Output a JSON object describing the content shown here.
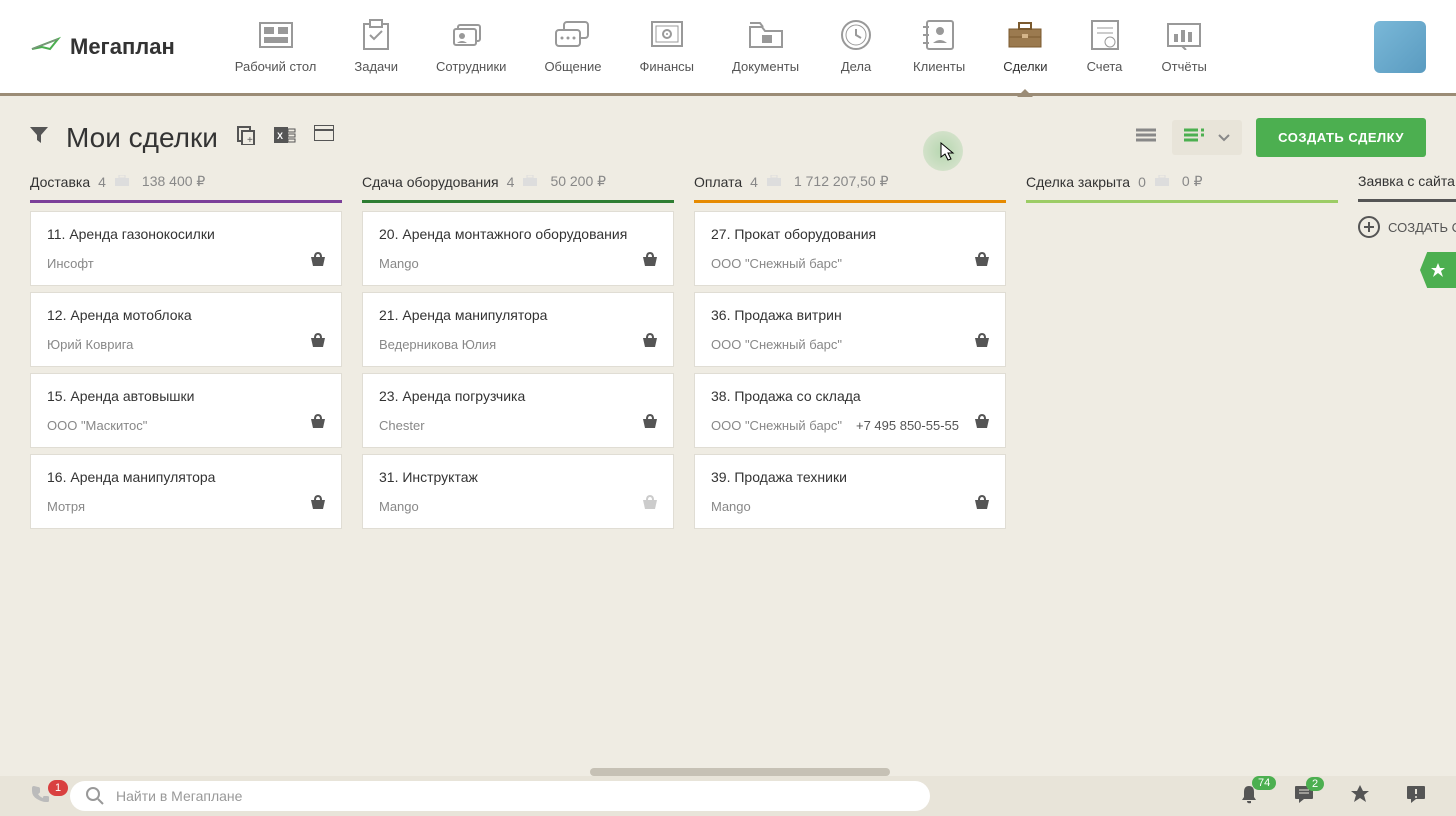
{
  "header": {
    "logo_text": "Мегаплан",
    "nav": [
      {
        "label": "Рабочий стол"
      },
      {
        "label": "Задачи"
      },
      {
        "label": "Сотрудники"
      },
      {
        "label": "Общение"
      },
      {
        "label": "Финансы"
      },
      {
        "label": "Документы"
      },
      {
        "label": "Дела"
      },
      {
        "label": "Клиенты"
      },
      {
        "label": "Сделки"
      },
      {
        "label": "Счета"
      },
      {
        "label": "Отчёты"
      }
    ]
  },
  "toolbar": {
    "title": "Мои сделки",
    "create_label": "СОЗДАТЬ СДЕЛКУ"
  },
  "columns": [
    {
      "name": "Доставка",
      "count": "4",
      "sum": "138 400 ₽",
      "cards": [
        {
          "title": "11. Аренда газонокосилки",
          "client": "Инсофт",
          "basket": "dark"
        },
        {
          "title": "12. Аренда мотоблока",
          "client": "Юрий Коврига",
          "basket": "dark"
        },
        {
          "title": "15. Аренда автовышки",
          "client": "ООО \"Маскитос\"",
          "basket": "dark"
        },
        {
          "title": "16. Аренда манипулятора",
          "client": "Мотря",
          "basket": "dark"
        }
      ]
    },
    {
      "name": "Сдача оборудования",
      "count": "4",
      "sum": "50 200 ₽",
      "cards": [
        {
          "title": "20. Аренда монтажного оборудования",
          "client": "Mango",
          "basket": "dark"
        },
        {
          "title": "21. Аренда манипулятора",
          "client": "Ведерникова Юлия",
          "basket": "dark"
        },
        {
          "title": "23. Аренда погрузчика",
          "client": "Chester",
          "basket": "dark"
        },
        {
          "title": "31. Инструктаж",
          "client": "Mango",
          "basket": "dim"
        }
      ]
    },
    {
      "name": "Оплата",
      "count": "4",
      "sum": "1 712 207,50 ₽",
      "cards": [
        {
          "title": "27. Прокат оборудования",
          "client": "ООО \"Снежный барс\"",
          "basket": "dark"
        },
        {
          "title": "36. Продажа витрин",
          "client": "ООО \"Снежный барс\"",
          "basket": "dark"
        },
        {
          "title": "38. Продажа со склада",
          "client": "ООО \"Снежный барс\"",
          "phone": "+7 495 850-55-55",
          "basket": "dark"
        },
        {
          "title": "39. Продажа техники",
          "client": "Mango",
          "basket": "dark"
        }
      ]
    },
    {
      "name": "Сделка закрыта",
      "count": "0",
      "sum": "0 ₽",
      "cards": []
    },
    {
      "name": "Заявка с сайта",
      "create_label": "СОЗДАТЬ С",
      "cards": []
    }
  ],
  "bottom": {
    "phone_badge": "1",
    "search_placeholder": "Найти в Мегаплане",
    "bell_badge": "74",
    "chat_badge": "2"
  }
}
